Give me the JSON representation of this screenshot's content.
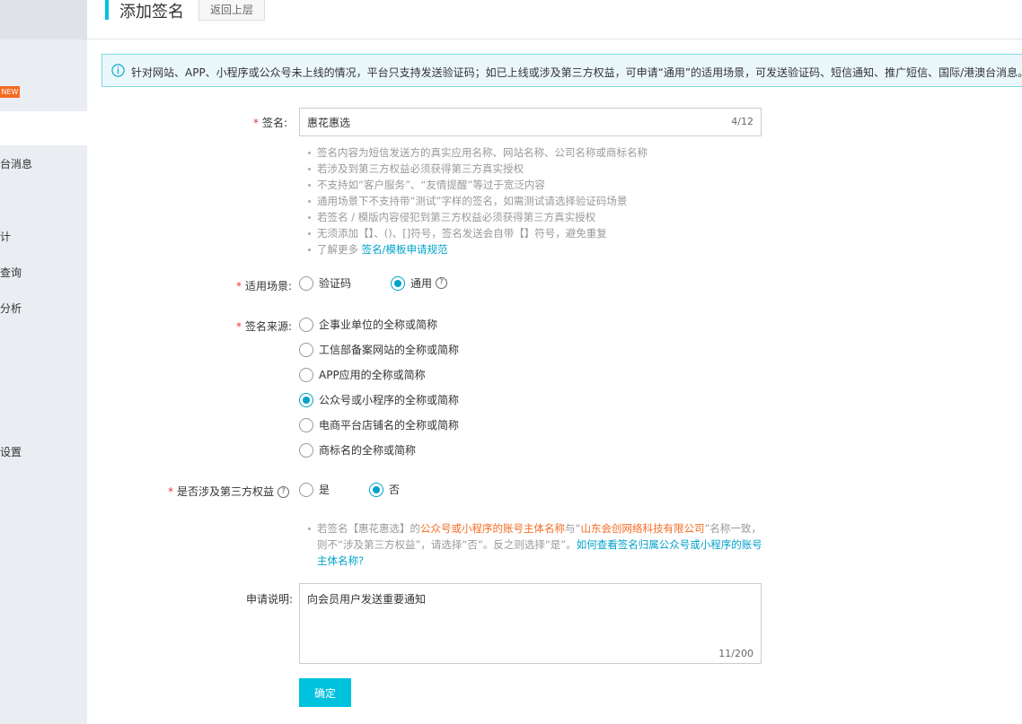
{
  "sidebar": {
    "badge_new": "NEW",
    "items": [
      {
        "label": "台消息"
      },
      {
        "label": "计"
      },
      {
        "label": "查询"
      },
      {
        "label": "分析"
      },
      {
        "label": "设置"
      }
    ]
  },
  "header": {
    "title": "添加签名",
    "back_label": "返回上层"
  },
  "notice": {
    "text": "针对网站、APP、小程序或公众号未上线的情况，平台只支持发送验证码；如已上线或涉及第三方权益，可申请“通用”的适用场景，可发送验证码、短信通知、推广短信、国际/港澳台消息。"
  },
  "form": {
    "signature": {
      "label": "签名:",
      "value": "惠花惠选",
      "counter": "4/12",
      "tips": [
        "签名内容为短信发送方的真实应用名称、网站名称、公司名称或商标名称",
        "若涉及到第三方权益必须获得第三方真实授权",
        "不支持如“客户服务”、“友情提醒”等过于宽泛内容",
        "通用场景下不支持带“测试”字样的签名，如需测试请选择验证码场景",
        "若签名 / 模版内容侵犯到第三方权益必须获得第三方真实授权",
        "无须添加【】、()、[]符号，签名发送会自带【】符号，避免重复"
      ],
      "more_prefix": "了解更多 ",
      "more_link": "签名/模板申请规范"
    },
    "scene": {
      "label": "适用场景:",
      "options": [
        "验证码",
        "通用"
      ],
      "selected": "通用",
      "help": "?"
    },
    "source": {
      "label": "签名来源:",
      "options": [
        "企事业单位的全称或简称",
        "工信部备案网站的全称或简称",
        "APP应用的全称或简称",
        "公众号或小程序的全称或简称",
        "电商平台店铺名的全称或简称",
        "商标名的全称或简称"
      ],
      "selected": "公众号或小程序的全称或简称"
    },
    "third_party": {
      "label": "是否涉及第三方权益",
      "help": "?",
      "options": [
        "是",
        "否"
      ],
      "selected": "否",
      "tip_parts": {
        "p1": "若签名【惠花惠选】的",
        "p2": "公众号或小程序的账号主体名称",
        "p3": "与“",
        "p4": "山东会创网络科技有限公司",
        "p5": "”名称一致，则不“涉及第三方权益”，请选择“否”。反之则选择“是”。",
        "link": "如何查看签名归属公众号或小程序的账号主体名称?"
      }
    },
    "description": {
      "label": "申请说明:",
      "value": "向会员用户发送重要通知",
      "counter": "11/200"
    },
    "submit_label": "确定"
  },
  "colors": {
    "accent": "#00c1de",
    "link": "#00a2ca",
    "required": "#e4393c",
    "highlight": "#f56c24"
  }
}
